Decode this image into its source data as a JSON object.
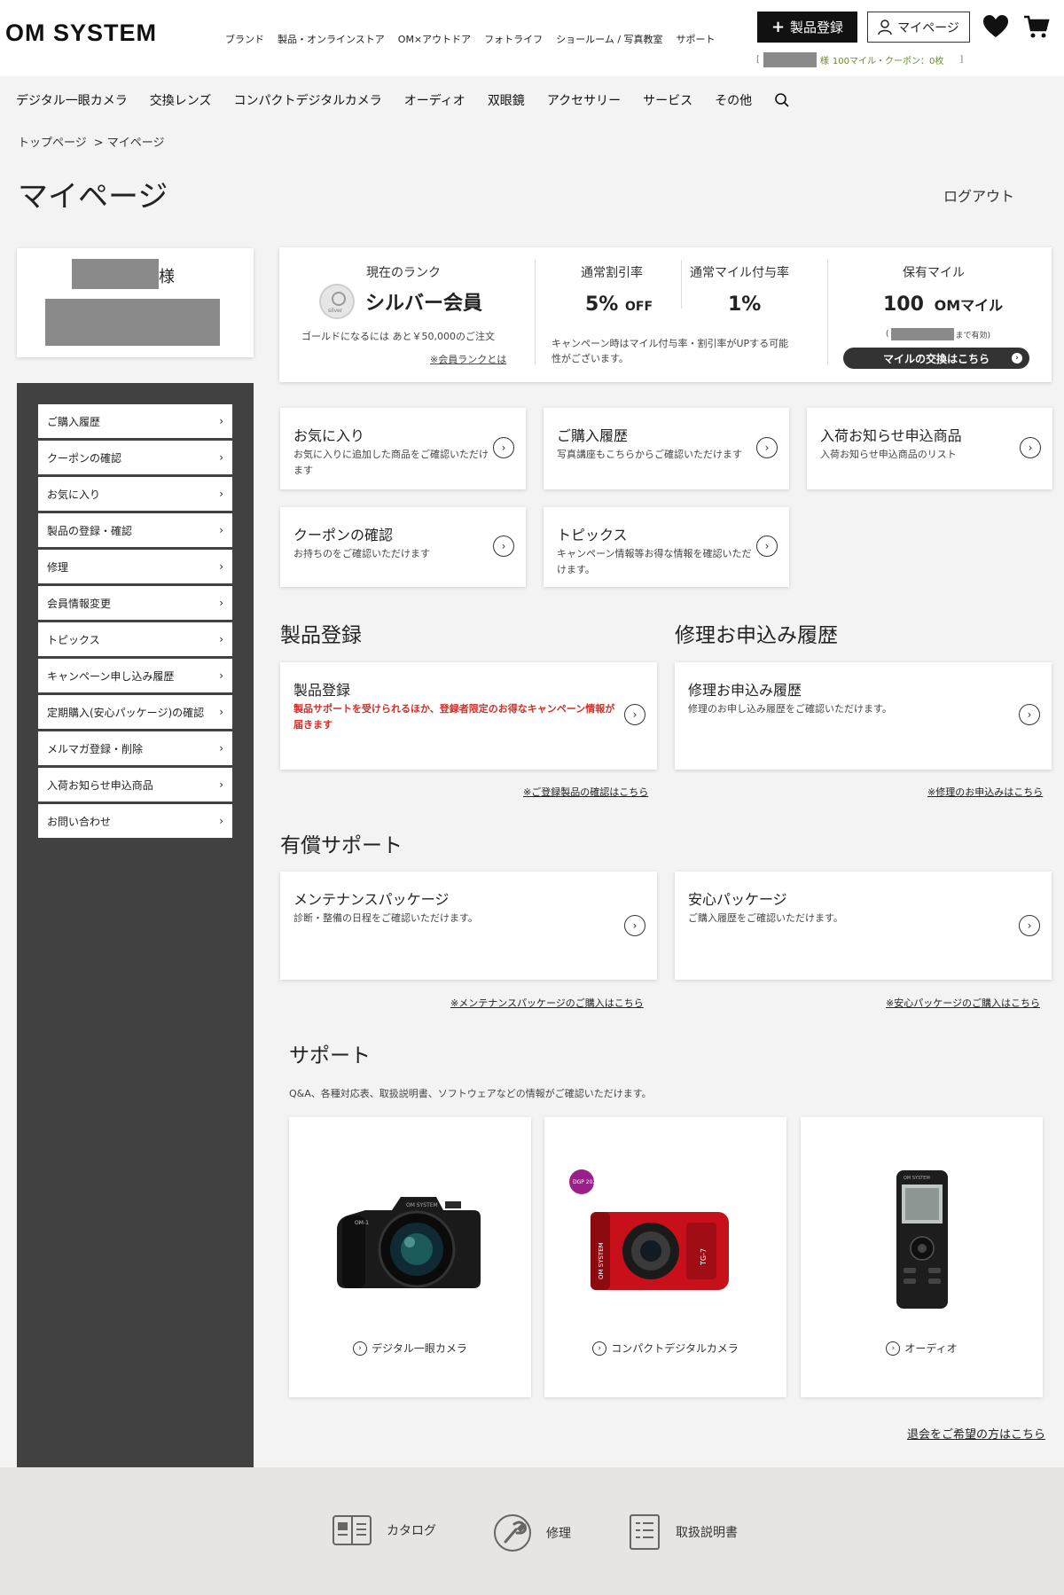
{
  "brand": {
    "logo": "OM SYSTEM"
  },
  "top_nav": [
    "ブランド",
    "製品・オンラインストア",
    "OM×アウトドア",
    "フォトライフ",
    "ショールーム / 写真教室",
    "サポート"
  ],
  "header": {
    "register_label": "製品登録",
    "mypage_label": "マイページ",
    "mile_prefix": "[",
    "mile_suffix": "様",
    "mile_text": "100マイル・クーポン：0枚",
    "mile_close": "]"
  },
  "category_nav": [
    "デジタル一眼カメラ",
    "交換レンズ",
    "コンパクトデジタルカメラ",
    "オーディオ",
    "双眼鏡",
    "アクセサリー",
    "サービス",
    "その他"
  ],
  "breadcrumb": [
    "トップページ",
    "> マイページ"
  ],
  "page_title": "マイページ",
  "logout_label": "ログアウト",
  "user": {
    "suffix": "様"
  },
  "sidebar": {
    "items": [
      "ご購入履歴",
      "クーポンの確認",
      "お気に入り",
      "製品の登録・確認",
      "修理",
      "会員情報変更",
      "トピックス",
      "キャンペーン申し込み履歴",
      "定期購入(安心パッケージ)の確認",
      "メルマガ登録・削除",
      "入荷お知らせ申込商品",
      "お問い合わせ"
    ],
    "chevron": "›"
  },
  "rank": {
    "current_label": "現在のランク",
    "medal_text": "silver",
    "rank_name": "シルバー会員",
    "next_text": "ゴールドになるには あと￥50,000のご注文",
    "about_link": "※会員ランクとは",
    "discount_label": "通常割引率",
    "discount_value": "5%",
    "discount_unit": "OFF",
    "mile_rate_label": "通常マイル付与率",
    "mile_rate_value": "1%",
    "campaign_note_1": "キャンペーン時はマイル付与率・割引率がUPする可能",
    "campaign_note_2": "性がございます。",
    "held_label": "保有マイル",
    "held_value": "100",
    "held_unit": "OMマイル",
    "expire_open": "(",
    "expire_text": "まで有効)",
    "exchange_label": "マイルの交換はこちら"
  },
  "quick_cards": [
    {
      "title": "お気に入り",
      "desc": "お気に入りに追加した商品をご確認いただけます"
    },
    {
      "title": "ご購入履歴",
      "desc": "写真講座もこちらからご確認いただけます"
    },
    {
      "title": "入荷お知らせ申込商品",
      "desc": "入荷お知らせ申込商品のリスト"
    },
    {
      "title": "クーポンの確認",
      "desc": "お持ちのをご確認いただけます"
    },
    {
      "title": "トピックス",
      "desc": "キャンペーン情報等お得な情報を確認いただけます。"
    }
  ],
  "sections": {
    "product_reg": {
      "heading": "製品登録",
      "card_title": "製品登録",
      "card_desc": "製品サポートを受けられるほか、登録者限定のお得なキャンペーン情報が届きます",
      "note": "※ご登録製品の確認はこちら"
    },
    "repair": {
      "heading": "修理お申込み履歴",
      "card_title": "修理お申込み履歴",
      "card_desc": "修理のお申し込み履歴をご確認いただけます。",
      "note": "※修理のお申込みはこちら"
    },
    "paid_support": {
      "heading": "有償サポート",
      "maint_title": "メンテナンスパッケージ",
      "maint_desc": "診断・整備の日程をご確認いただけます。",
      "maint_note": "※メンテナンスパッケージのご購入はこちら",
      "anshin_title": "安心パッケージ",
      "anshin_desc": "ご購入履歴をご確認いただけます。",
      "anshin_note": "※安心パッケージのご購入はこちら"
    },
    "support": {
      "heading": "サポート",
      "desc": "Q&A、各種対応表、取扱説明書、ソフトウェアなどの情報がご確認いただけます。",
      "products": [
        {
          "label": "デジタル一眼カメラ",
          "brand_text": "OM SYSTEM",
          "model_text": "OM-1"
        },
        {
          "label": "コンパクトデジタルカメラ",
          "brand_text": "OM SYSTEM",
          "badge_text": "DGP 2023 金賞",
          "model_text": "TG-7"
        },
        {
          "label": "オーディオ",
          "brand_text": "OM SYSTEM"
        }
      ]
    }
  },
  "withdraw_link": "退会をご希望の方はこちら",
  "footer": [
    "カタログ",
    "修理",
    "取扱説明書"
  ],
  "colors": {
    "accent_red": "#d0302a",
    "sidebar_bg": "#414141",
    "mile_green": "#6a8e2a",
    "camera_red": "#c8101a"
  }
}
